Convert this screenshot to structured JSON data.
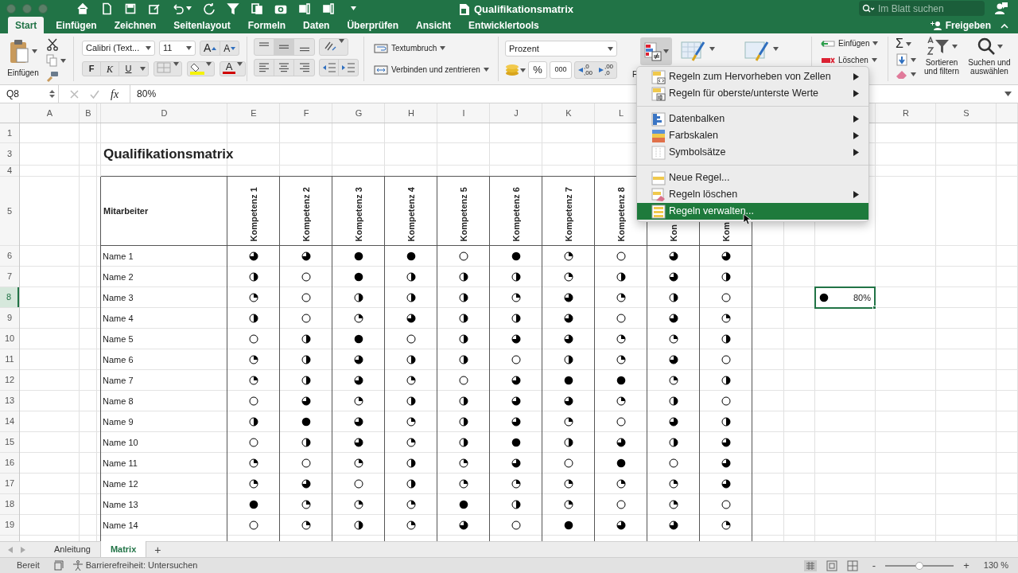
{
  "window": {
    "title": "Qualifikationsmatrix"
  },
  "search": {
    "placeholder": "Im Blatt suchen"
  },
  "share_button": "Freigeben",
  "tabs": [
    {
      "label": "Start",
      "selected": true
    },
    {
      "label": "Einfügen",
      "selected": false
    },
    {
      "label": "Zeichnen",
      "selected": false
    },
    {
      "label": "Seitenlayout",
      "selected": false
    },
    {
      "label": "Formeln",
      "selected": false
    },
    {
      "label": "Daten",
      "selected": false
    },
    {
      "label": "Überprüfen",
      "selected": false
    },
    {
      "label": "Ansicht",
      "selected": false
    },
    {
      "label": "Entwicklertools",
      "selected": false
    }
  ],
  "ribbon": {
    "paste_label": "Einfügen",
    "font_name": "Calibri (Text...",
    "font_size": "11",
    "grow_font": "A",
    "shrink_font": "A",
    "bold": "F",
    "italic": "K",
    "underline": "U",
    "font_color": "A",
    "wrap_text": "Textumbruch",
    "merge_center": "Verbinden und zentrieren",
    "number_format": "Prozent",
    "percent": "%",
    "thousands": "000",
    "decimal_increase": [
      ",0",
      ",00"
    ],
    "decimal_decrease": [
      ",00",
      ",0"
    ],
    "styles_label": "F",
    "insert_cells": "Einfügen",
    "delete_cells": "Löschen",
    "autosum": "Σ",
    "sort_filter": "Sortieren und filtern",
    "find_select": "Suchen und auswählen"
  },
  "formula_bar": {
    "name_box": "Q8",
    "fx": "fx",
    "value": "80%"
  },
  "column_headers": [
    "A",
    "B",
    "D",
    "E",
    "F",
    "G",
    "H",
    "I",
    "J",
    "K",
    "L",
    "R",
    "S"
  ],
  "row_headers": [
    {
      "label": "1",
      "selected": false
    },
    {
      "label": "3",
      "selected": false
    },
    {
      "label": "4",
      "selected": false
    },
    {
      "label": "5",
      "selected": false
    },
    {
      "label": "6",
      "selected": false
    },
    {
      "label": "7",
      "selected": false
    },
    {
      "label": "8",
      "selected": true
    },
    {
      "label": "9",
      "selected": false
    },
    {
      "label": "10",
      "selected": false
    },
    {
      "label": "11",
      "selected": false
    },
    {
      "label": "12",
      "selected": false
    },
    {
      "label": "13",
      "selected": false
    },
    {
      "label": "14",
      "selected": false
    },
    {
      "label": "15",
      "selected": false
    },
    {
      "label": "16",
      "selected": false
    },
    {
      "label": "17",
      "selected": false
    },
    {
      "label": "18",
      "selected": false
    },
    {
      "label": "19",
      "selected": false
    }
  ],
  "sheet": {
    "title": "Qualifikationsmatrix",
    "header_label": "Mitarbeiter",
    "competencies": [
      "Kompetenz 1",
      "Kompetenz 2",
      "Kompetenz 3",
      "Kompetenz 4",
      "Kompetenz 5",
      "Kompetenz 6",
      "Kompetenz 7",
      "Kompetenz 8",
      "Kon",
      "Kom"
    ],
    "rows": [
      {
        "name": "Name 1",
        "scores": [
          {
            "kind": "three_quarter"
          },
          {
            "kind": "three_quarter"
          },
          {
            "kind": "full"
          },
          {
            "kind": "full"
          },
          {
            "kind": "empty"
          },
          {
            "kind": "full"
          },
          {
            "kind": "quarter"
          },
          {
            "kind": "empty"
          },
          {
            "kind": "three_quarter"
          },
          {
            "kind": "three_quarter"
          }
        ]
      },
      {
        "name": "Name 2",
        "scores": [
          {
            "kind": "half"
          },
          {
            "kind": "empty"
          },
          {
            "kind": "full"
          },
          {
            "kind": "half"
          },
          {
            "kind": "half"
          },
          {
            "kind": "half"
          },
          {
            "kind": "quarter"
          },
          {
            "kind": "half"
          },
          {
            "kind": "three_quarter"
          },
          {
            "kind": "half"
          }
        ]
      },
      {
        "name": "Name 3",
        "scores": [
          {
            "kind": "quarter"
          },
          {
            "kind": "empty"
          },
          {
            "kind": "half"
          },
          {
            "kind": "half"
          },
          {
            "kind": "half"
          },
          {
            "kind": "quarter"
          },
          {
            "kind": "three_quarter"
          },
          {
            "kind": "quarter"
          },
          {
            "kind": "half"
          },
          {
            "kind": "empty"
          }
        ]
      },
      {
        "name": "Name 4",
        "scores": [
          {
            "kind": "half"
          },
          {
            "kind": "empty"
          },
          {
            "kind": "quarter"
          },
          {
            "kind": "three_quarter"
          },
          {
            "kind": "half"
          },
          {
            "kind": "half"
          },
          {
            "kind": "three_quarter"
          },
          {
            "kind": "empty"
          },
          {
            "kind": "three_quarter"
          },
          {
            "kind": "quarter"
          }
        ]
      },
      {
        "name": "Name 5",
        "scores": [
          {
            "kind": "empty"
          },
          {
            "kind": "half"
          },
          {
            "kind": "full"
          },
          {
            "kind": "empty"
          },
          {
            "kind": "half"
          },
          {
            "kind": "three_quarter"
          },
          {
            "kind": "three_quarter"
          },
          {
            "kind": "quarter"
          },
          {
            "kind": "quarter"
          },
          {
            "kind": "half"
          }
        ]
      },
      {
        "name": "Name 6",
        "scores": [
          {
            "kind": "quarter"
          },
          {
            "kind": "half"
          },
          {
            "kind": "three_quarter"
          },
          {
            "kind": "half"
          },
          {
            "kind": "half"
          },
          {
            "kind": "empty"
          },
          {
            "kind": "half"
          },
          {
            "kind": "quarter"
          },
          {
            "kind": "three_quarter"
          },
          {
            "kind": "empty"
          }
        ]
      },
      {
        "name": "Name 7",
        "scores": [
          {
            "kind": "quarter"
          },
          {
            "kind": "half"
          },
          {
            "kind": "three_quarter"
          },
          {
            "kind": "quarter"
          },
          {
            "kind": "empty"
          },
          {
            "kind": "three_quarter"
          },
          {
            "kind": "full"
          },
          {
            "kind": "full"
          },
          {
            "kind": "quarter"
          },
          {
            "kind": "half"
          }
        ]
      },
      {
        "name": "Name 8",
        "scores": [
          {
            "kind": "empty"
          },
          {
            "kind": "three_quarter"
          },
          {
            "kind": "quarter"
          },
          {
            "kind": "half"
          },
          {
            "kind": "half"
          },
          {
            "kind": "three_quarter"
          },
          {
            "kind": "three_quarter"
          },
          {
            "kind": "quarter"
          },
          {
            "kind": "half"
          },
          {
            "kind": "empty"
          }
        ]
      },
      {
        "name": "Name 9",
        "scores": [
          {
            "kind": "half"
          },
          {
            "kind": "full"
          },
          {
            "kind": "three_quarter"
          },
          {
            "kind": "quarter"
          },
          {
            "kind": "half"
          },
          {
            "kind": "three_quarter"
          },
          {
            "kind": "quarter"
          },
          {
            "kind": "empty"
          },
          {
            "kind": "three_quarter"
          },
          {
            "kind": "half"
          }
        ]
      },
      {
        "name": "Name 10",
        "scores": [
          {
            "kind": "empty"
          },
          {
            "kind": "half"
          },
          {
            "kind": "three_quarter"
          },
          {
            "kind": "quarter"
          },
          {
            "kind": "half"
          },
          {
            "kind": "full"
          },
          {
            "kind": "half"
          },
          {
            "kind": "three_quarter"
          },
          {
            "kind": "half"
          },
          {
            "kind": "three_quarter"
          }
        ]
      },
      {
        "name": "Name 11",
        "scores": [
          {
            "kind": "quarter"
          },
          {
            "kind": "empty"
          },
          {
            "kind": "quarter"
          },
          {
            "kind": "half"
          },
          {
            "kind": "quarter"
          },
          {
            "kind": "three_quarter"
          },
          {
            "kind": "empty"
          },
          {
            "kind": "full"
          },
          {
            "kind": "empty"
          },
          {
            "kind": "three_quarter"
          }
        ]
      },
      {
        "name": "Name 12",
        "scores": [
          {
            "kind": "quarter"
          },
          {
            "kind": "three_quarter"
          },
          {
            "kind": "empty"
          },
          {
            "kind": "half"
          },
          {
            "kind": "quarter"
          },
          {
            "kind": "quarter"
          },
          {
            "kind": "quarter"
          },
          {
            "kind": "quarter"
          },
          {
            "kind": "quarter"
          },
          {
            "kind": "three_quarter"
          }
        ]
      },
      {
        "name": "Name 13",
        "scores": [
          {
            "kind": "full"
          },
          {
            "kind": "quarter"
          },
          {
            "kind": "quarter"
          },
          {
            "kind": "quarter"
          },
          {
            "kind": "full"
          },
          {
            "kind": "half"
          },
          {
            "kind": "quarter"
          },
          {
            "kind": "empty"
          },
          {
            "kind": "quarter"
          },
          {
            "kind": "empty"
          }
        ]
      },
      {
        "name": "Name 14",
        "scores": [
          {
            "kind": "empty"
          },
          {
            "kind": "quarter"
          },
          {
            "kind": "half"
          },
          {
            "kind": "quarter"
          },
          {
            "kind": "three_quarter"
          },
          {
            "kind": "empty"
          },
          {
            "kind": "full"
          },
          {
            "kind": "three_quarter"
          },
          {
            "kind": "three_quarter"
          },
          {
            "kind": "quarter"
          }
        ]
      }
    ]
  },
  "selected_cell": {
    "kind": "full",
    "value": "80%"
  },
  "context_menu": {
    "groups": [
      [
        {
          "kind": "highlight",
          "label": "Regeln zum Hervorheben von Zellen",
          "submenu": true,
          "selected": false
        },
        {
          "kind": "topbottom",
          "label": "Regeln für oberste/unterste Werte",
          "submenu": true,
          "selected": false
        }
      ],
      [
        {
          "kind": "databar",
          "label": "Datenbalken",
          "submenu": true,
          "selected": false
        },
        {
          "kind": "colorscale",
          "label": "Farbskalen",
          "submenu": true,
          "selected": false
        },
        {
          "kind": "iconset",
          "label": "Symbolsätze",
          "submenu": true,
          "selected": false
        }
      ],
      [
        {
          "kind": "newrule",
          "label": "Neue Regel...",
          "submenu": false,
          "selected": false
        },
        {
          "kind": "clear",
          "label": "Regeln löschen",
          "submenu": true,
          "selected": false
        },
        {
          "kind": "manage",
          "label": "Regeln verwalten...",
          "submenu": false,
          "selected": true
        }
      ]
    ]
  },
  "sheet_tabs": [
    {
      "label": "Anleitung",
      "selected": false
    },
    {
      "label": "Matrix",
      "selected": true
    }
  ],
  "add_sheet": "+",
  "status_bar": {
    "status": "Bereit",
    "accessibility": "Barrierefreiheit: Untersuchen",
    "zoom_out": "-",
    "zoom_in": "+",
    "zoom": {
      "level": 0.5
    },
    "zoom_label": "130 %"
  }
}
